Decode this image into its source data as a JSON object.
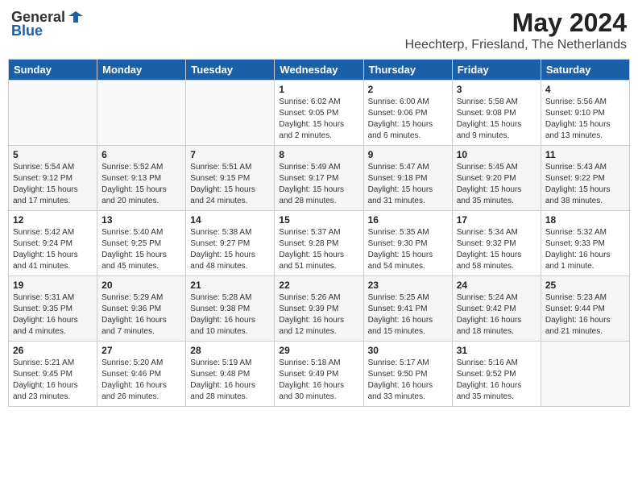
{
  "logo": {
    "general": "General",
    "blue": "Blue"
  },
  "title": "May 2024",
  "subtitle": "Heechterp, Friesland, The Netherlands",
  "days_of_week": [
    "Sunday",
    "Monday",
    "Tuesday",
    "Wednesday",
    "Thursday",
    "Friday",
    "Saturday"
  ],
  "weeks": [
    [
      {
        "day": "",
        "info": ""
      },
      {
        "day": "",
        "info": ""
      },
      {
        "day": "",
        "info": ""
      },
      {
        "day": "1",
        "info": "Sunrise: 6:02 AM\nSunset: 9:05 PM\nDaylight: 15 hours\nand 2 minutes."
      },
      {
        "day": "2",
        "info": "Sunrise: 6:00 AM\nSunset: 9:06 PM\nDaylight: 15 hours\nand 6 minutes."
      },
      {
        "day": "3",
        "info": "Sunrise: 5:58 AM\nSunset: 9:08 PM\nDaylight: 15 hours\nand 9 minutes."
      },
      {
        "day": "4",
        "info": "Sunrise: 5:56 AM\nSunset: 9:10 PM\nDaylight: 15 hours\nand 13 minutes."
      }
    ],
    [
      {
        "day": "5",
        "info": "Sunrise: 5:54 AM\nSunset: 9:12 PM\nDaylight: 15 hours\nand 17 minutes."
      },
      {
        "day": "6",
        "info": "Sunrise: 5:52 AM\nSunset: 9:13 PM\nDaylight: 15 hours\nand 20 minutes."
      },
      {
        "day": "7",
        "info": "Sunrise: 5:51 AM\nSunset: 9:15 PM\nDaylight: 15 hours\nand 24 minutes."
      },
      {
        "day": "8",
        "info": "Sunrise: 5:49 AM\nSunset: 9:17 PM\nDaylight: 15 hours\nand 28 minutes."
      },
      {
        "day": "9",
        "info": "Sunrise: 5:47 AM\nSunset: 9:18 PM\nDaylight: 15 hours\nand 31 minutes."
      },
      {
        "day": "10",
        "info": "Sunrise: 5:45 AM\nSunset: 9:20 PM\nDaylight: 15 hours\nand 35 minutes."
      },
      {
        "day": "11",
        "info": "Sunrise: 5:43 AM\nSunset: 9:22 PM\nDaylight: 15 hours\nand 38 minutes."
      }
    ],
    [
      {
        "day": "12",
        "info": "Sunrise: 5:42 AM\nSunset: 9:24 PM\nDaylight: 15 hours\nand 41 minutes."
      },
      {
        "day": "13",
        "info": "Sunrise: 5:40 AM\nSunset: 9:25 PM\nDaylight: 15 hours\nand 45 minutes."
      },
      {
        "day": "14",
        "info": "Sunrise: 5:38 AM\nSunset: 9:27 PM\nDaylight: 15 hours\nand 48 minutes."
      },
      {
        "day": "15",
        "info": "Sunrise: 5:37 AM\nSunset: 9:28 PM\nDaylight: 15 hours\nand 51 minutes."
      },
      {
        "day": "16",
        "info": "Sunrise: 5:35 AM\nSunset: 9:30 PM\nDaylight: 15 hours\nand 54 minutes."
      },
      {
        "day": "17",
        "info": "Sunrise: 5:34 AM\nSunset: 9:32 PM\nDaylight: 15 hours\nand 58 minutes."
      },
      {
        "day": "18",
        "info": "Sunrise: 5:32 AM\nSunset: 9:33 PM\nDaylight: 16 hours\nand 1 minute."
      }
    ],
    [
      {
        "day": "19",
        "info": "Sunrise: 5:31 AM\nSunset: 9:35 PM\nDaylight: 16 hours\nand 4 minutes."
      },
      {
        "day": "20",
        "info": "Sunrise: 5:29 AM\nSunset: 9:36 PM\nDaylight: 16 hours\nand 7 minutes."
      },
      {
        "day": "21",
        "info": "Sunrise: 5:28 AM\nSunset: 9:38 PM\nDaylight: 16 hours\nand 10 minutes."
      },
      {
        "day": "22",
        "info": "Sunrise: 5:26 AM\nSunset: 9:39 PM\nDaylight: 16 hours\nand 12 minutes."
      },
      {
        "day": "23",
        "info": "Sunrise: 5:25 AM\nSunset: 9:41 PM\nDaylight: 16 hours\nand 15 minutes."
      },
      {
        "day": "24",
        "info": "Sunrise: 5:24 AM\nSunset: 9:42 PM\nDaylight: 16 hours\nand 18 minutes."
      },
      {
        "day": "25",
        "info": "Sunrise: 5:23 AM\nSunset: 9:44 PM\nDaylight: 16 hours\nand 21 minutes."
      }
    ],
    [
      {
        "day": "26",
        "info": "Sunrise: 5:21 AM\nSunset: 9:45 PM\nDaylight: 16 hours\nand 23 minutes."
      },
      {
        "day": "27",
        "info": "Sunrise: 5:20 AM\nSunset: 9:46 PM\nDaylight: 16 hours\nand 26 minutes."
      },
      {
        "day": "28",
        "info": "Sunrise: 5:19 AM\nSunset: 9:48 PM\nDaylight: 16 hours\nand 28 minutes."
      },
      {
        "day": "29",
        "info": "Sunrise: 5:18 AM\nSunset: 9:49 PM\nDaylight: 16 hours\nand 30 minutes."
      },
      {
        "day": "30",
        "info": "Sunrise: 5:17 AM\nSunset: 9:50 PM\nDaylight: 16 hours\nand 33 minutes."
      },
      {
        "day": "31",
        "info": "Sunrise: 5:16 AM\nSunset: 9:52 PM\nDaylight: 16 hours\nand 35 minutes."
      },
      {
        "day": "",
        "info": ""
      }
    ]
  ]
}
